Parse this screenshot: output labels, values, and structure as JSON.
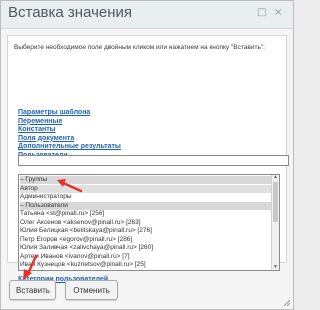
{
  "window": {
    "title": "Вставка значения",
    "minimize_icon": "□",
    "close_icon": "×"
  },
  "hint": "Выберите необходимое поле двойным кликом или нажатием на кнопку \"Вставить\":",
  "links": [
    "Параметры шаблона",
    "Переменные",
    "Константы",
    "Поля документа",
    "Дополнительные результаты",
    "Пользователи"
  ],
  "search": {
    "value": "",
    "placeholder": ""
  },
  "list": {
    "rows": [
      "– Группы",
      "Автор",
      "Администраторы",
      "– Пользователи",
      "Татьяна <st@pinall.ru> [256]",
      "Олег Аксенов <aksenov@pinall.ru> [263]",
      "Юлия Белицкая <belitskaya@pinall.ru> [276]",
      "Петр Егоров <egorov@pinall.ru> [286]",
      "Юлия Заливчая <zalivchaya@pinall.ru> [260]",
      "Артем Иванов <ivanov@pinall.ru> [7]",
      "Иван Кузнецов <kuznetsov@pinall.ru> [25]"
    ]
  },
  "category_link": "Категории пользователей",
  "buttons": {
    "insert": "Вставить",
    "cancel": "Отменить"
  },
  "colors": {
    "link": "#1f63b6",
    "arrow": "#e8302a",
    "titlebar": "#e9eef1"
  }
}
